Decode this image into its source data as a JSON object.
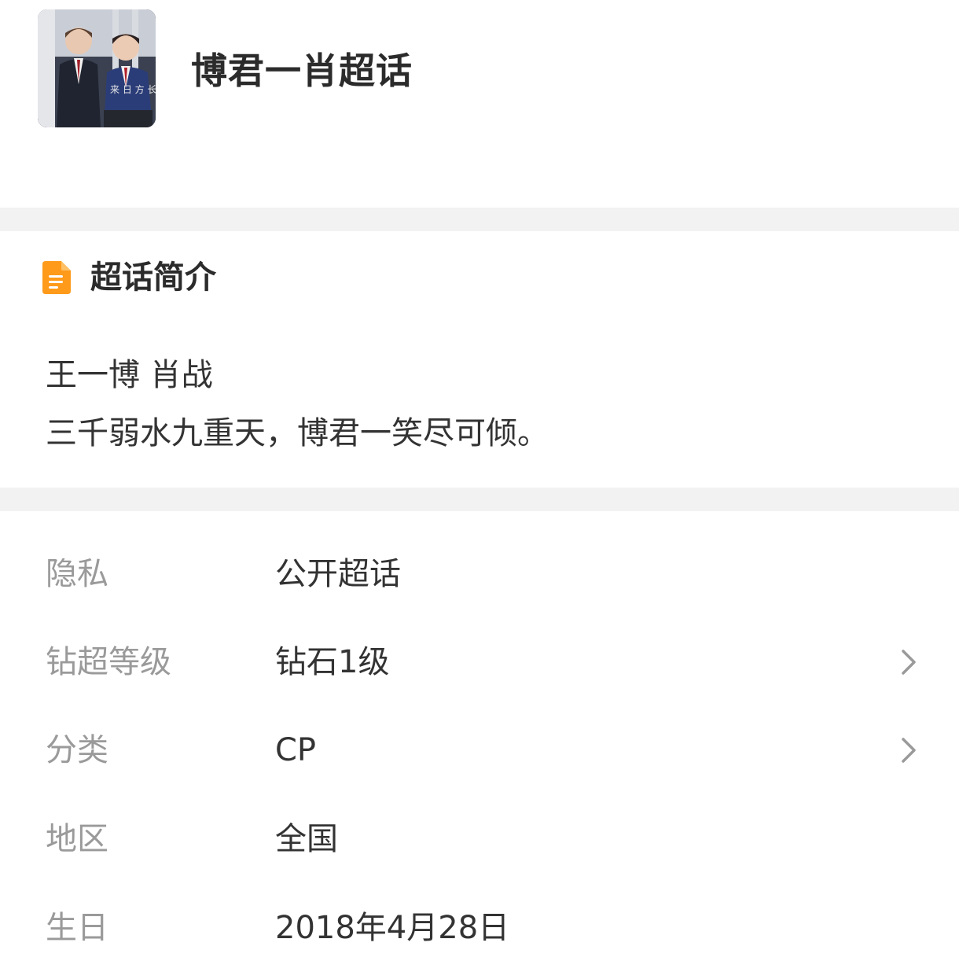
{
  "header": {
    "title": "博君一肖超话",
    "avatar_icon": "topic-avatar-image"
  },
  "intro": {
    "icon": "document-icon",
    "icon_color": "#ff9a1a",
    "heading": "超话简介",
    "lines": [
      "王一博 肖战",
      "三千弱水九重天，博君一笑尽可倾。"
    ]
  },
  "info": {
    "rows": [
      {
        "label": "隐私",
        "value": "公开超话",
        "has_chevron": false
      },
      {
        "label": "钻超等级",
        "value": "钻石1级",
        "has_chevron": true
      },
      {
        "label": "分类",
        "value": "CP",
        "has_chevron": true
      },
      {
        "label": "地区",
        "value": "全国",
        "has_chevron": false
      },
      {
        "label": "生日",
        "value": "2018年4月28日",
        "has_chevron": false
      }
    ]
  },
  "colors": {
    "divider": "#f2f2f2",
    "label": "#9a9a9a",
    "value": "#333333",
    "chevron": "#9a9a9a"
  }
}
